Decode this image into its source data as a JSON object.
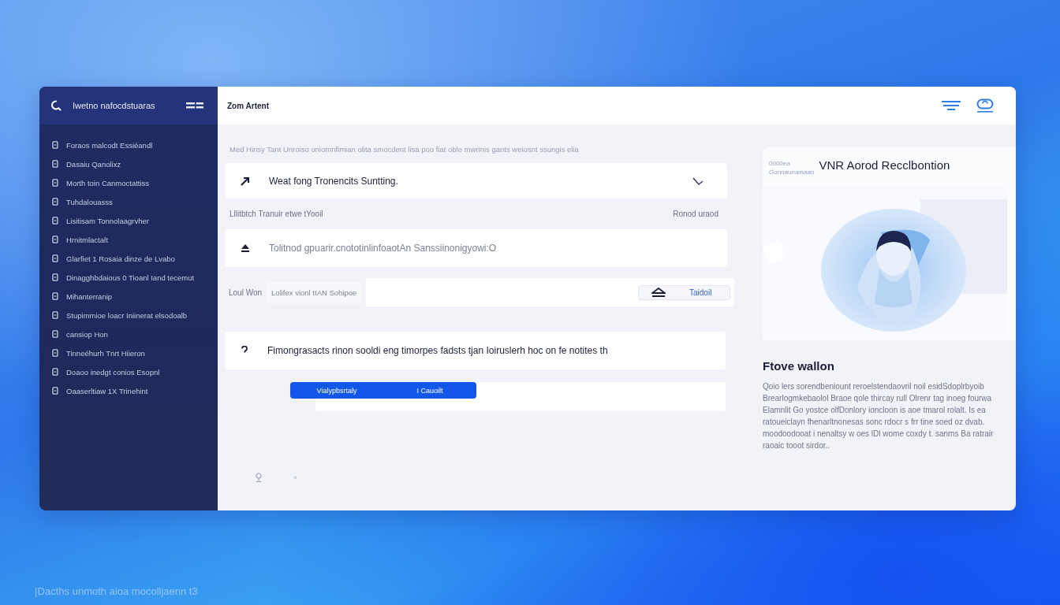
{
  "sidebar": {
    "title": "Iwetno nafocdstuaras",
    "items": [
      {
        "label": "Foraos malcodt Essiéandl"
      },
      {
        "label": "Dasaiu Qanolixz"
      },
      {
        "label": "Morth toin Canmoctattiss"
      },
      {
        "label": "Tuhdalouasss"
      },
      {
        "label": "Lisitisam Tonnolaagrvher"
      },
      {
        "label": "Hrnitmlactalt"
      },
      {
        "label": "Glarfiet 1 Rosaia dinze de Lvabo"
      },
      {
        "label": "Dinagghbdaious 0 Tioanl Iand tecemut"
      },
      {
        "label": "Mihanterranip"
      },
      {
        "label": "Stupimmioe loacr Iniinerat elsodoalb"
      },
      {
        "label": "cansiop Hon"
      },
      {
        "label": "Tinneéhurh Tnrt Hiieron"
      },
      {
        "label": "Doaoo inedgt conios Esopnl"
      },
      {
        "label": "Oaaserltiaw 1X Trinehint"
      }
    ]
  },
  "topbar": {
    "title": "Zom Artent"
  },
  "intro": "Med Hirisy Tant Unroiso oniomnfimian olita smocdent lisa poo fiat oble mwrinis gants weiosnt ssungis elia",
  "summary_item": {
    "text": "Weat fong Tronencits Suntting."
  },
  "labels": {
    "left": "Lllitbtch Tranuir etwe tYooil",
    "right": "Ronod uraod"
  },
  "note_item": {
    "text": "Tolitnod gpuarir.cnototinlinfoaotAn Sanssiinonigyowi:O"
  },
  "input_row": {
    "label": "Loul Won",
    "hint": "Lolifex vionl tIAN Sohipoe",
    "button": "Taidoil"
  },
  "question_item": {
    "text": "Fimongrasacts rinon sooldi eng timorpes fadsts tjan Ioiruslerh hoc on fe notites th"
  },
  "segmented": {
    "options": [
      {
        "label": "Vialypbsrtaly"
      },
      {
        "label": "I Cauoilt"
      }
    ]
  },
  "preview": {
    "caption": "0000ea",
    "title": "VNR Aorod Recclbontion",
    "subtitle": "Gonnaunamaan"
  },
  "details": {
    "heading": "Ftove wallon",
    "paragraph": "Qoio lers sorendbeniount reroelstendaovril noil esidSdoplrbyoib Brearlogmkebaolol Braoe qole thircay rull Olrenr tag inoeg fourwa Elamnlit Go yostce olfDonlory ioncloon is aoe tmarol rolalt. Is ea ratoueiclayn fhenarltnonesas sonc rdocr s frr tine soed oz dvab. moodoodooat i nenaltsy w oes lDl wome coxdy t. sanms Ba ratrair raoaic tooot sirdor.."
  },
  "wallpaper_caption": "[Dacths unmoth aioa mocolljaenn t3"
}
